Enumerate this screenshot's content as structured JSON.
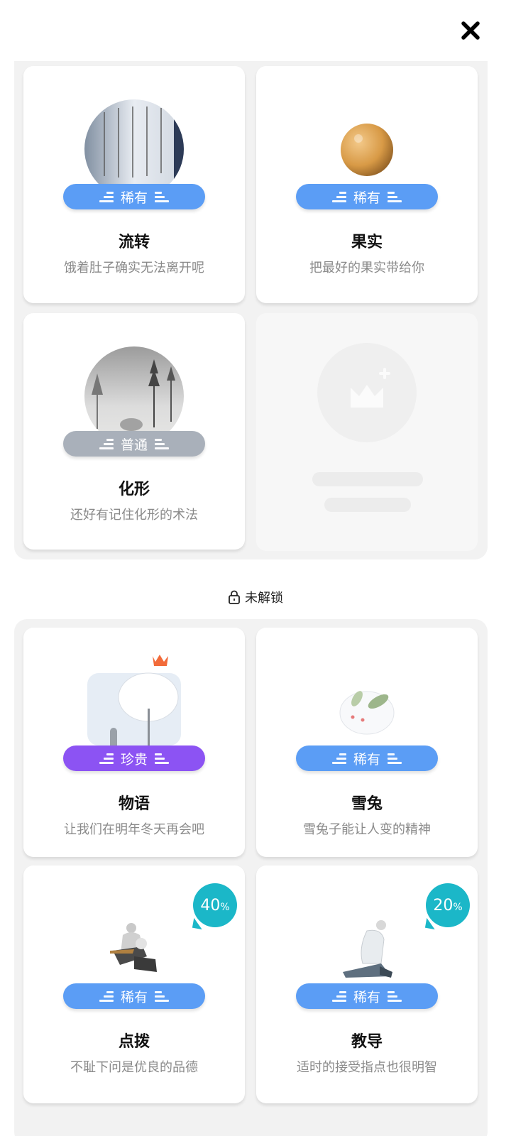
{
  "close": {
    "icon": "close-icon"
  },
  "unlocked_cards": [
    {
      "title": "流转",
      "desc": "饿着肚子确实无法离开呢",
      "rarity": "稀有"
    },
    {
      "title": "果实",
      "desc": "把最好的果实带给你",
      "rarity": "稀有"
    },
    {
      "title": "化形",
      "desc": "还好有记住化形的术法",
      "rarity": "普通"
    }
  ],
  "placeholder": {
    "icon": "add-image-icon"
  },
  "locked_section": {
    "label": "未解锁",
    "icon": "lock-icon"
  },
  "locked_cards": [
    {
      "title": "物语",
      "desc": "让我们在明年冬天再会吧",
      "rarity": "珍贵"
    },
    {
      "title": "雪兔",
      "desc": "雪兔子能让人变的精神",
      "rarity": "稀有"
    },
    {
      "title": "点拨",
      "desc": "不耻下问是优良的品德",
      "rarity": "稀有",
      "progress": "40",
      "progress_unit": "%"
    },
    {
      "title": "教导",
      "desc": "适时的接受指点也很明智",
      "rarity": "稀有",
      "progress": "20",
      "progress_unit": "%"
    }
  ],
  "colors": {
    "rare": "#5b9df5",
    "common": "#a9b0ba",
    "precious": "#8c53f3",
    "progress": "#1bb7c8",
    "crown": "#f26b3a"
  }
}
